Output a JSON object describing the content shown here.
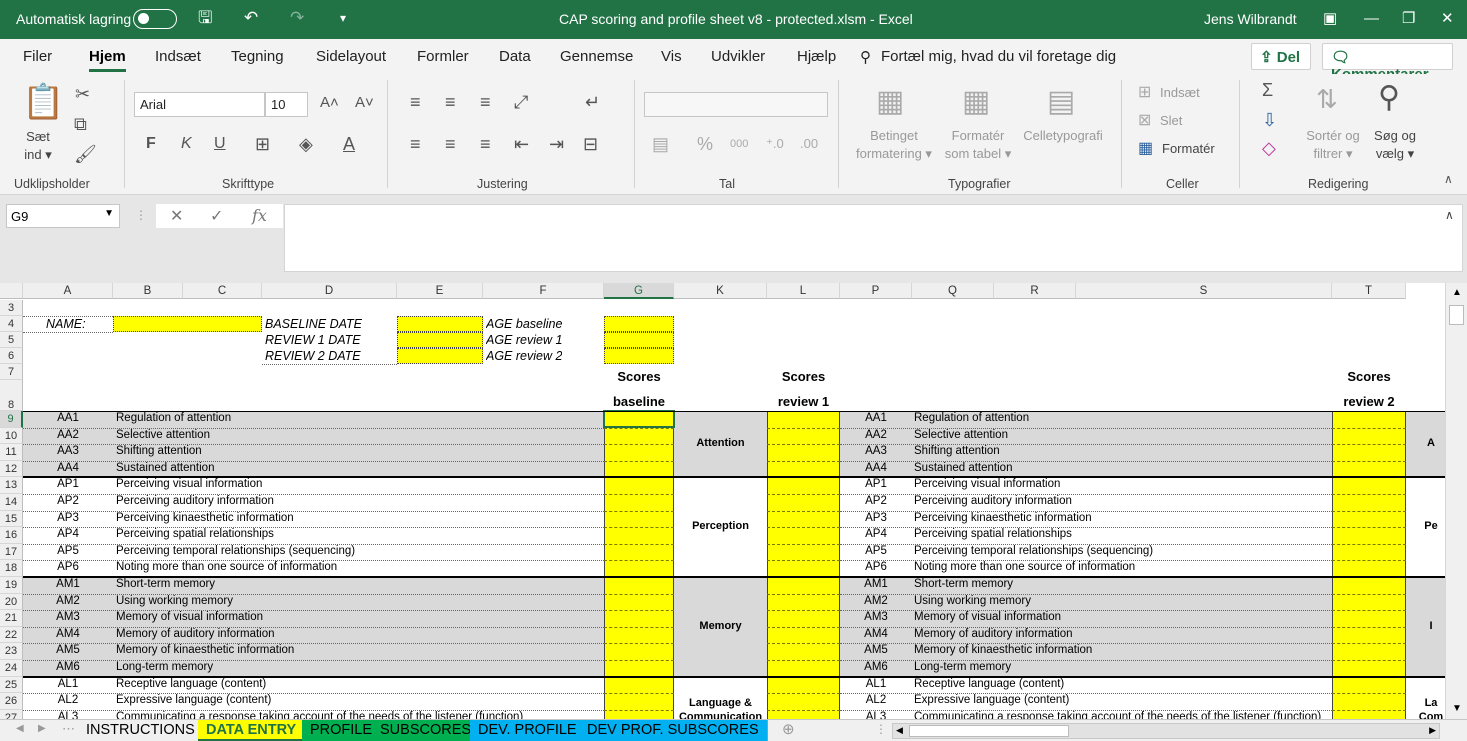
{
  "app": {
    "autosave_label": "Automatisk lagring",
    "title": "CAP scoring and profile sheet v8 - protected.xlsm  -  Excel",
    "user": "Jens Wilbrandt"
  },
  "ribbon_tabs": [
    "Filer",
    "Hjem",
    "Indsæt",
    "Tegning",
    "Sidelayout",
    "Formler",
    "Data",
    "Gennemse",
    "Vis",
    "Udvikler",
    "Hjælp"
  ],
  "tell_me": "Fortæl mig, hvad du vil foretage dig",
  "share_label": "Del",
  "comments_label": "Kommentarer",
  "ribbon": {
    "paste_label": "Sæt",
    "paste_label2": "ind ▾",
    "font_name": "Arial",
    "font_size": "10",
    "bold": "F",
    "italic": "K",
    "underline": "U",
    "number_format": "",
    "percent": "%",
    "thousands": "000",
    "cond_format": "Betinget",
    "cond_format2": "formatering ▾",
    "format_table": "Formatér",
    "format_table2": "som tabel ▾",
    "cell_styles": "Celletypografi",
    "insert": "Indsæt",
    "delete": "Slet",
    "format": "Formatér",
    "sort": "Sortér og",
    "sort2": "filtrer ▾",
    "find": "Søg og",
    "find2": "vælg ▾",
    "groups": [
      "Udklipsholder",
      "Skrifttype",
      "Justering",
      "Tal",
      "Typografier",
      "Celler",
      "Redigering"
    ]
  },
  "name_box": "G9",
  "fx": "fx",
  "formula_value": "",
  "columns": [
    "A",
    "B",
    "C",
    "D",
    "E",
    "F",
    "G",
    "K",
    "L",
    "P",
    "Q",
    "R",
    "S",
    "T"
  ],
  "rows": [
    "3",
    "4",
    "5",
    "6",
    "7",
    "8",
    "9",
    "10",
    "11",
    "12",
    "13",
    "14",
    "15",
    "16",
    "17",
    "18",
    "19",
    "20",
    "21",
    "22",
    "23",
    "24",
    "25",
    "26",
    "27"
  ],
  "header_block": {
    "name": "NAME:",
    "baseline_date": "BASELINE DATE",
    "review1_date": "REVIEW 1 DATE",
    "review2_date": "REVIEW 2 DATE",
    "age_baseline": "AGE baseline",
    "age_review1": "AGE review 1",
    "age_review2": "AGE review 2"
  },
  "score_headers": {
    "baseline_1": "Scores",
    "baseline_2": "baseline",
    "review1_1": "Scores",
    "review1_2": "review 1",
    "review2_1": "Scores",
    "review2_2": "review 2"
  },
  "items": [
    {
      "code": "AA1",
      "desc": "Regulation of attention"
    },
    {
      "code": "AA2",
      "desc": "Selective attention"
    },
    {
      "code": "AA3",
      "desc": "Shifting attention"
    },
    {
      "code": "AA4",
      "desc": "Sustained attention"
    },
    {
      "code": "AP1",
      "desc": "Perceiving visual information"
    },
    {
      "code": "AP2",
      "desc": "Perceiving auditory information"
    },
    {
      "code": "AP3",
      "desc": "Perceiving kinaesthetic information"
    },
    {
      "code": "AP4",
      "desc": "Perceiving spatial relationships"
    },
    {
      "code": "AP5",
      "desc": "Perceiving temporal relationships (sequencing)"
    },
    {
      "code": "AP6",
      "desc": "Noting more than one source of information"
    },
    {
      "code": "AM1",
      "desc": "Short-term memory"
    },
    {
      "code": "AM2",
      "desc": "Using working memory"
    },
    {
      "code": "AM3",
      "desc": "Memory of visual information"
    },
    {
      "code": "AM4",
      "desc": "Memory of auditory information"
    },
    {
      "code": "AM5",
      "desc": "Memory of kinaesthetic information"
    },
    {
      "code": "AM6",
      "desc": "Long-term memory"
    },
    {
      "code": "AL1",
      "desc": "Receptive language (content)"
    },
    {
      "code": "AL2",
      "desc": "Expressive language (content)"
    },
    {
      "code": "AL3",
      "desc": "Communicating a response taking account of the needs of the listener (function)"
    }
  ],
  "domains": [
    {
      "label": "Attention",
      "right": "A"
    },
    {
      "label": "Perception",
      "right": "Pe"
    },
    {
      "label": "Memory",
      "right": "I"
    },
    {
      "label": "Language & Communication",
      "label1": "Language &",
      "label2": "Communication",
      "right": "La",
      "right2": "Com"
    }
  ],
  "sheet_tabs": [
    "INSTRUCTIONS",
    "DATA ENTRY",
    "PROFILE",
    "SUBSCORES",
    "DEV. PROFILE",
    "DEV PROF. SUBSCORES"
  ],
  "colors": {
    "excel_green": "#217346",
    "yellow": "#ffff00",
    "band_gray": "#d9d9d9",
    "tab_active": "#ffff00",
    "tab_profile": "#00b050",
    "tab_dev": "#00b0f0"
  }
}
